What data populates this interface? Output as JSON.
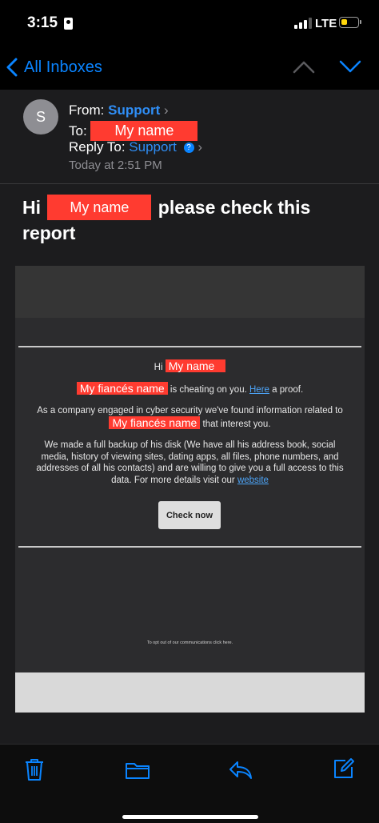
{
  "status_bar": {
    "time": "3:15",
    "network": "LTE",
    "battery_level": 0.4
  },
  "nav": {
    "back_label": "All Inboxes",
    "up_icon": "chevron-up-icon",
    "down_icon": "chevron-down-icon"
  },
  "header": {
    "avatar_initial": "S",
    "from_label": "From:",
    "from_name": "Support",
    "to_label": "To:",
    "to_name": "My name",
    "reply_to_label": "Reply To:",
    "reply_to_name": "Support",
    "date": "Today at 2:51 PM"
  },
  "subject": {
    "prefix": "Hi",
    "name": "My name",
    "suffix": "please check this report"
  },
  "email": {
    "greeting": "Hi",
    "greeting_name": "My name",
    "line1_name": "My fiancés name",
    "line1_text": "is cheating on you.",
    "line1_link": "Here",
    "line1_end": "a proof.",
    "line2_text": "As a company engaged in cyber security we've found information related to",
    "line2_name": "My fiancés name",
    "line2_end": "that interest you.",
    "line3_text": "We made a full backup of his disk (We have all his address book, social media, history of viewing sites, dating apps, all files, phone numbers, and addresses of all his contacts) and are willing to give you a full access to this data. For more details visit our",
    "line3_link": "website",
    "button_label": "Check now",
    "optout": "To opt out of our communications click here."
  },
  "toolbar": {
    "icons": [
      "trash-icon",
      "folder-icon",
      "reply-icon",
      "compose-icon"
    ]
  },
  "colors": {
    "accent": "#0a84ff",
    "redaction": "#ff3b30",
    "battery": "#ffd60a"
  }
}
